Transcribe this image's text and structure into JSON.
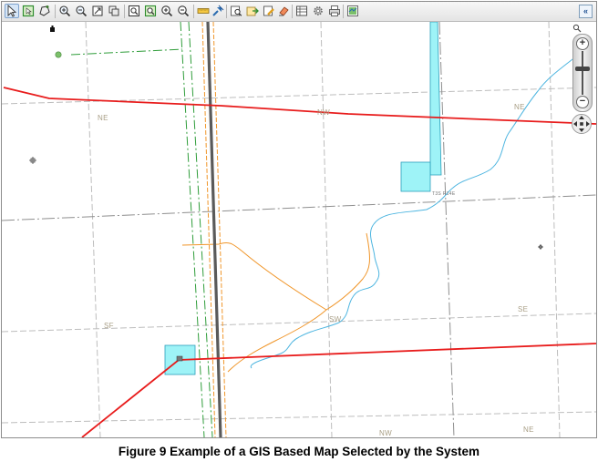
{
  "toolbar": {
    "buttons": [
      {
        "icon": "select-arrow-icon",
        "active": true
      },
      {
        "icon": "select-box-icon"
      },
      {
        "icon": "select-polygon-icon"
      },
      {
        "icon": "zoom-in-tool-icon"
      },
      {
        "icon": "zoom-out-tool-icon"
      },
      {
        "icon": "full-extent-icon"
      },
      {
        "icon": "pan-tool-icon"
      },
      {
        "icon": "zoom-window-icon"
      },
      {
        "icon": "zoom-selection-icon"
      },
      {
        "icon": "zoom-in-icon"
      },
      {
        "icon": "zoom-out-icon"
      },
      {
        "icon": "measure-icon"
      },
      {
        "icon": "identify-icon"
      },
      {
        "icon": "find-icon"
      },
      {
        "icon": "export-icon"
      },
      {
        "icon": "highlight-icon"
      },
      {
        "icon": "clear-icon"
      },
      {
        "icon": "table-icon"
      },
      {
        "icon": "settings-icon"
      },
      {
        "icon": "print-icon"
      },
      {
        "icon": "legend-icon"
      }
    ],
    "collapse_label": "«"
  },
  "map": {
    "labels": [
      {
        "id": "ne-1",
        "text": "NE"
      },
      {
        "id": "nw-1",
        "text": "NW"
      },
      {
        "id": "ne-2",
        "text": "NE"
      },
      {
        "id": "township",
        "text": "T3S R14E"
      },
      {
        "id": "sf",
        "text": "SF"
      },
      {
        "id": "sw",
        "text": "SW"
      },
      {
        "id": "se",
        "text": "SE"
      },
      {
        "id": "nw-2",
        "text": "NW"
      },
      {
        "id": "ne-3",
        "text": "NE"
      }
    ],
    "colors": {
      "pipeline": "#e81c1c",
      "stream": "#4db5e0",
      "water_body": "#9ef3f7",
      "road": "#555555",
      "orange_line": "#f0962a",
      "green_line": "#2f9d3a",
      "grid": "#b4b4b4"
    }
  },
  "zoom": {
    "search_icon": "magnifier-icon",
    "plus_label": "+",
    "minus_label": "−",
    "level": 0.6
  },
  "caption": "Figure 9 Example of a GIS Based Map Selected by the System"
}
